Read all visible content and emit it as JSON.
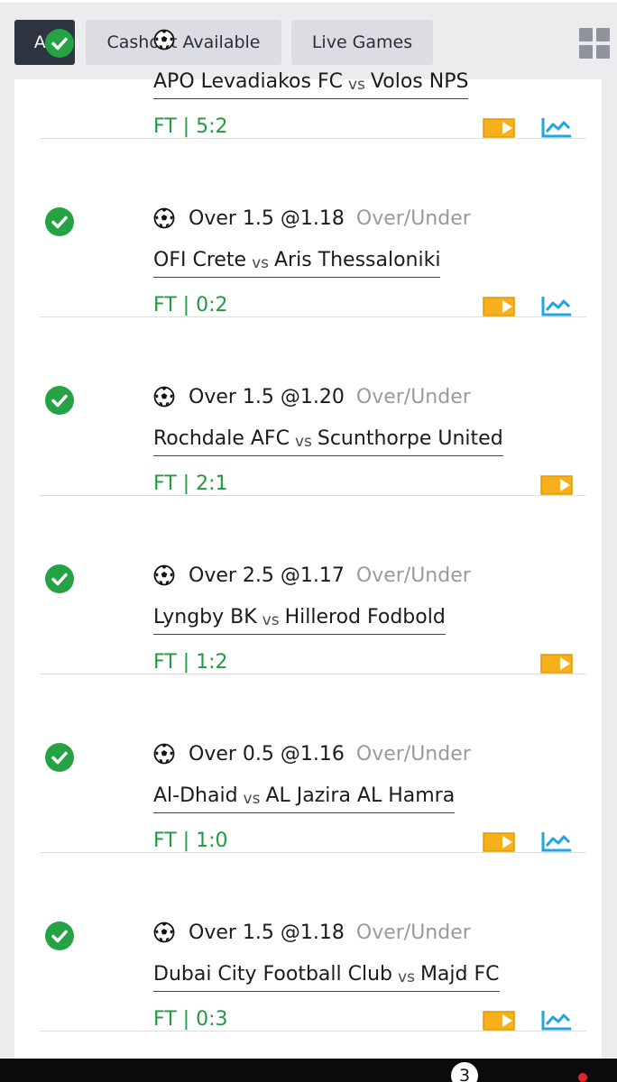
{
  "filters": {
    "all_label": "All",
    "cashout_label": "Cashout Available",
    "live_label": "Live Games"
  },
  "colors": {
    "win_green": "#25a244",
    "score_green": "#229a42",
    "video_orange": "#f5b01c",
    "stats_blue": "#1ea5e6",
    "active_filter": "#2e3440"
  },
  "bets": [
    {
      "home": "APO Levadiakos FC",
      "vs": "vs",
      "away": "Volos NPS",
      "result": "FT | 5:2",
      "status": "won",
      "has_stats": true
    },
    {
      "selection": "Over 1.5 @1.18",
      "market": "Over/Under",
      "home": "OFI Crete",
      "vs": "vs",
      "away": "Aris Thessaloniki",
      "result": "FT | 0:2",
      "status": "won",
      "has_stats": true
    },
    {
      "selection": "Over 1.5 @1.20",
      "market": "Over/Under",
      "home": "Rochdale AFC",
      "vs": "vs",
      "away": "Scunthorpe United",
      "result": "FT | 2:1",
      "status": "won",
      "has_stats": false
    },
    {
      "selection": "Over 2.5 @1.17",
      "market": "Over/Under",
      "home": "Lyngby BK",
      "vs": "vs",
      "away": "Hillerod Fodbold",
      "result": "FT | 1:2",
      "status": "won",
      "has_stats": false
    },
    {
      "selection": "Over 0.5 @1.16",
      "market": "Over/Under",
      "home": "Al-Dhaid",
      "vs": "vs",
      "away": "AL Jazira AL Hamra",
      "result": "FT | 1:0",
      "status": "won",
      "has_stats": true
    },
    {
      "selection": "Over 1.5 @1.18",
      "market": "Over/Under",
      "home": "Dubai City Football Club",
      "vs": "vs",
      "away": "Majd FC",
      "result": "FT | 0:3",
      "status": "won",
      "has_stats": true
    }
  ],
  "bottom_bar": {
    "badge_count": "3"
  }
}
